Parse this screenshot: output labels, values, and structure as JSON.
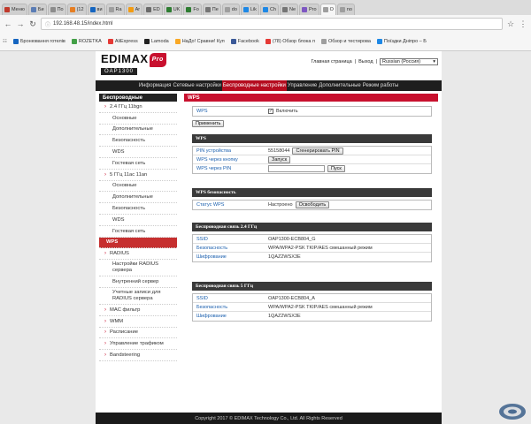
{
  "browser": {
    "tabs": [
      {
        "label": "Меню",
        "color": "#c0392b"
      },
      {
        "label": "Би",
        "color": "#5b7db5"
      },
      {
        "label": "По",
        "color": "#8c8c8c"
      },
      {
        "label": "(12",
        "color": "#e67e22"
      },
      {
        "label": "ви",
        "color": "#1565c0"
      },
      {
        "label": "Ra",
        "color": "#9e9e9e"
      },
      {
        "label": "Ar",
        "color": "#f39c12"
      },
      {
        "label": "ED",
        "color": "#6a6a6a"
      },
      {
        "label": "UK",
        "color": "#2e7d32"
      },
      {
        "label": "Fo",
        "color": "#2e7d32"
      },
      {
        "label": "Пе",
        "color": "#757575"
      },
      {
        "label": "do",
        "color": "#9e9e9e"
      },
      {
        "label": "Lik",
        "color": "#1e88e5"
      },
      {
        "label": "Ch",
        "color": "#1e88e5"
      },
      {
        "label": "Ne",
        "color": "#757575"
      },
      {
        "label": "Pro",
        "color": "#7e57c2"
      },
      {
        "label": "O",
        "color": "#9e9e9e",
        "active": true
      },
      {
        "label": "no",
        "color": "#9e9e9e"
      }
    ],
    "url": "192.168.48.15/index.html",
    "bookmarks": [
      {
        "label": "Бронювання готелів",
        "color": "#1565c0"
      },
      {
        "label": "ROZETKA",
        "color": "#43a047"
      },
      {
        "label": "AliExpress",
        "color": "#e53935"
      },
      {
        "label": "Lamoda",
        "color": "#212121"
      },
      {
        "label": "НаДо! Сравни! Куп",
        "color": "#f9a825"
      },
      {
        "label": "Facebook",
        "color": "#3b5998"
      },
      {
        "label": "(78) Обзор блока п",
        "color": "#e53935"
      },
      {
        "label": "Обзор и тестирова",
        "color": "#9e9e9e"
      },
      {
        "label": "Поїздки Дніпро – Б",
        "color": "#1e88e5"
      }
    ]
  },
  "header": {
    "logo": "EDIMAX",
    "logo_pro": "Pro",
    "model": "OAP1300",
    "home_link": "Главная страница",
    "separator": "|",
    "logout_link": "Выход",
    "separator2": "|",
    "language": "Russian (Россия)"
  },
  "mainnav": [
    {
      "label": "Информация"
    },
    {
      "label": "Сетевые настройки"
    },
    {
      "label": "Беспроводные настройки",
      "active": true
    },
    {
      "label": "Управление"
    },
    {
      "label": "Дополнительные"
    },
    {
      "label": "Режим работы"
    }
  ],
  "sidebar": {
    "title": "Беспроводные",
    "items": [
      {
        "label": "2.4 ГГц 11bgn",
        "type": "cat"
      },
      {
        "label": "Основные",
        "type": "sub"
      },
      {
        "label": "Дополнительные",
        "type": "sub"
      },
      {
        "label": "Безопасность",
        "type": "sub"
      },
      {
        "label": "WDS",
        "type": "sub"
      },
      {
        "label": "Гостевая сеть",
        "type": "sub"
      },
      {
        "label": "5 ГГц 11ac 11an",
        "type": "cat"
      },
      {
        "label": "Основные",
        "type": "sub"
      },
      {
        "label": "Дополнительные",
        "type": "sub"
      },
      {
        "label": "Безопасность",
        "type": "sub"
      },
      {
        "label": "WDS",
        "type": "sub"
      },
      {
        "label": "Гостевая сеть",
        "type": "sub"
      },
      {
        "label": "WPS",
        "type": "active"
      },
      {
        "label": "RADIUS",
        "type": "cat"
      },
      {
        "label": "Настройки RADIUS сервера",
        "type": "sub",
        "two": true
      },
      {
        "label": "Внутренний сервер",
        "type": "sub"
      },
      {
        "label": "Учетные записи для RADIUS сервера",
        "type": "sub",
        "two": true
      },
      {
        "label": "MAC фильтр",
        "type": "cat"
      },
      {
        "label": "WMM",
        "type": "cat"
      },
      {
        "label": "Расписание",
        "type": "cat"
      },
      {
        "label": "Управление трафиком",
        "type": "cat"
      },
      {
        "label": "Bandsteering",
        "type": "cat"
      }
    ]
  },
  "content": {
    "title": "WPS",
    "wps_label": "WPS",
    "wps_enable_label": "Включить",
    "wps_enabled": true,
    "apply_button": "Применить",
    "wps_section": "WPS",
    "pin_label": "PIN устройства",
    "pin_value": "55158044",
    "generate_pin_button": "Сгенерировать PIN",
    "button_mode_label": "WPS через кнопку",
    "start_button": "Запуск",
    "pin_mode_label": "WPS через PIN",
    "pin_input_value": "",
    "start_pin_button": "Пуск",
    "security_section": "WPS безопасность",
    "status_label": "Статус WPS",
    "status_value": "Настроено",
    "release_button": "Освободить",
    "wireless24_section": "Беспроводная связь 2.4 ГГц",
    "wireless24": [
      {
        "label": "SSID",
        "value": "OAP1300-ECB804_G"
      },
      {
        "label": "Безопасность",
        "value": "WPA/WPA2-PSK TKIP/AES смешанный режим"
      },
      {
        "label": "Шифрование",
        "value": "1QAZ2WSX3E"
      }
    ],
    "wireless5_section": "Беспроводная связь 5 ГГц",
    "wireless5": [
      {
        "label": "SSID",
        "value": "OAP1300-ECB804_A"
      },
      {
        "label": "Безопасность",
        "value": "WPA/WPA2-PSK TKIP/AES смешанный режим"
      },
      {
        "label": "Шифрование",
        "value": "1QAZ2WSX3E"
      }
    ]
  },
  "footer": "Copyright 2017 © EDIMAX Technology Co., Ltd. All Rights Reserved",
  "colors": {
    "accent": "#c8102e",
    "nav_bg": "#1e1e1e",
    "section_bg": "#3a3a3a"
  }
}
